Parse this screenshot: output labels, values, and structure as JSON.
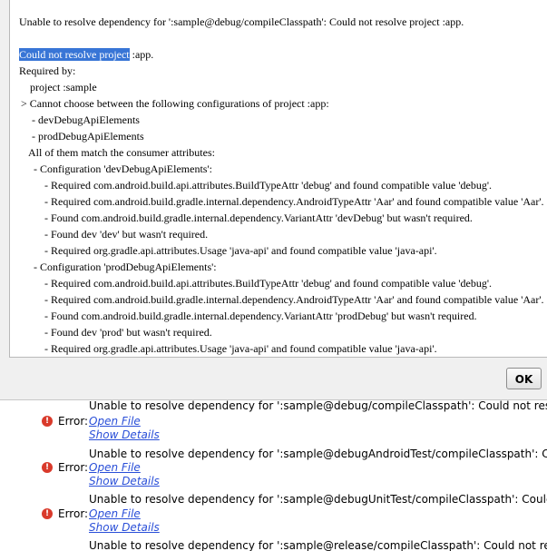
{
  "dialog": {
    "header_line": "Unable to resolve dependency for ':sample@debug/compileClasspath': Could not resolve project :app.",
    "selected_text": "Could not resolve project",
    "after_selection": " :app.",
    "required_by": "Required by:",
    "project": "project :sample",
    "cannot_choose": "> Cannot choose between the following configurations of project :app:",
    "config_list": [
      "- devDebugApiElements",
      "- prodDebugApiElements"
    ],
    "match_line": "All of them match the consumer attributes:",
    "config1_header": "- Configuration 'devDebugApiElements':",
    "config1_details": [
      "- Required com.android.build.api.attributes.BuildTypeAttr 'debug' and found compatible value 'debug'.",
      "- Required com.android.build.gradle.internal.dependency.AndroidTypeAttr 'Aar' and found compatible value 'Aar'.",
      "- Found com.android.build.gradle.internal.dependency.VariantAttr 'devDebug' but wasn't required.",
      "- Found dev 'dev' but wasn't required.",
      "- Required org.gradle.api.attributes.Usage 'java-api' and found compatible value 'java-api'."
    ],
    "config2_header": "- Configuration 'prodDebugApiElements':",
    "config2_details": [
      "- Required com.android.build.api.attributes.BuildTypeAttr 'debug' and found compatible value 'debug'.",
      "- Required com.android.build.gradle.internal.dependency.AndroidTypeAttr 'Aar' and found compatible value 'Aar'.",
      "- Found com.android.build.gradle.internal.dependency.VariantAttr 'prodDebug' but wasn't required.",
      "- Found dev 'prod' but wasn't required.",
      "- Required org.gradle.api.attributes.Usage 'java-api' and found compatible value 'java-api'."
    ],
    "ok_label": "OK"
  },
  "messages": {
    "error_label": "Error:",
    "error_icon": "error-icon",
    "error_color": "#d93a2b",
    "link_color": "#2a4fd8",
    "open_file": "Open File",
    "show_details": "Show Details",
    "items": [
      "Unable to resolve dependency for ':sample@debug/compileClasspath': Could not resolve project :app.",
      "Unable to resolve dependency for ':sample@debugAndroidTest/compileClasspath': Could not resolve project :app.",
      "Unable to resolve dependency for ':sample@debugUnitTest/compileClasspath': Could not resolve project :app.",
      "Unable to resolve dependency for ':sample@release/compileClasspath': Could not resolve project :app."
    ]
  },
  "colors": {
    "selection": "#3875d6",
    "dialog_bg": "#f0f0f0"
  }
}
